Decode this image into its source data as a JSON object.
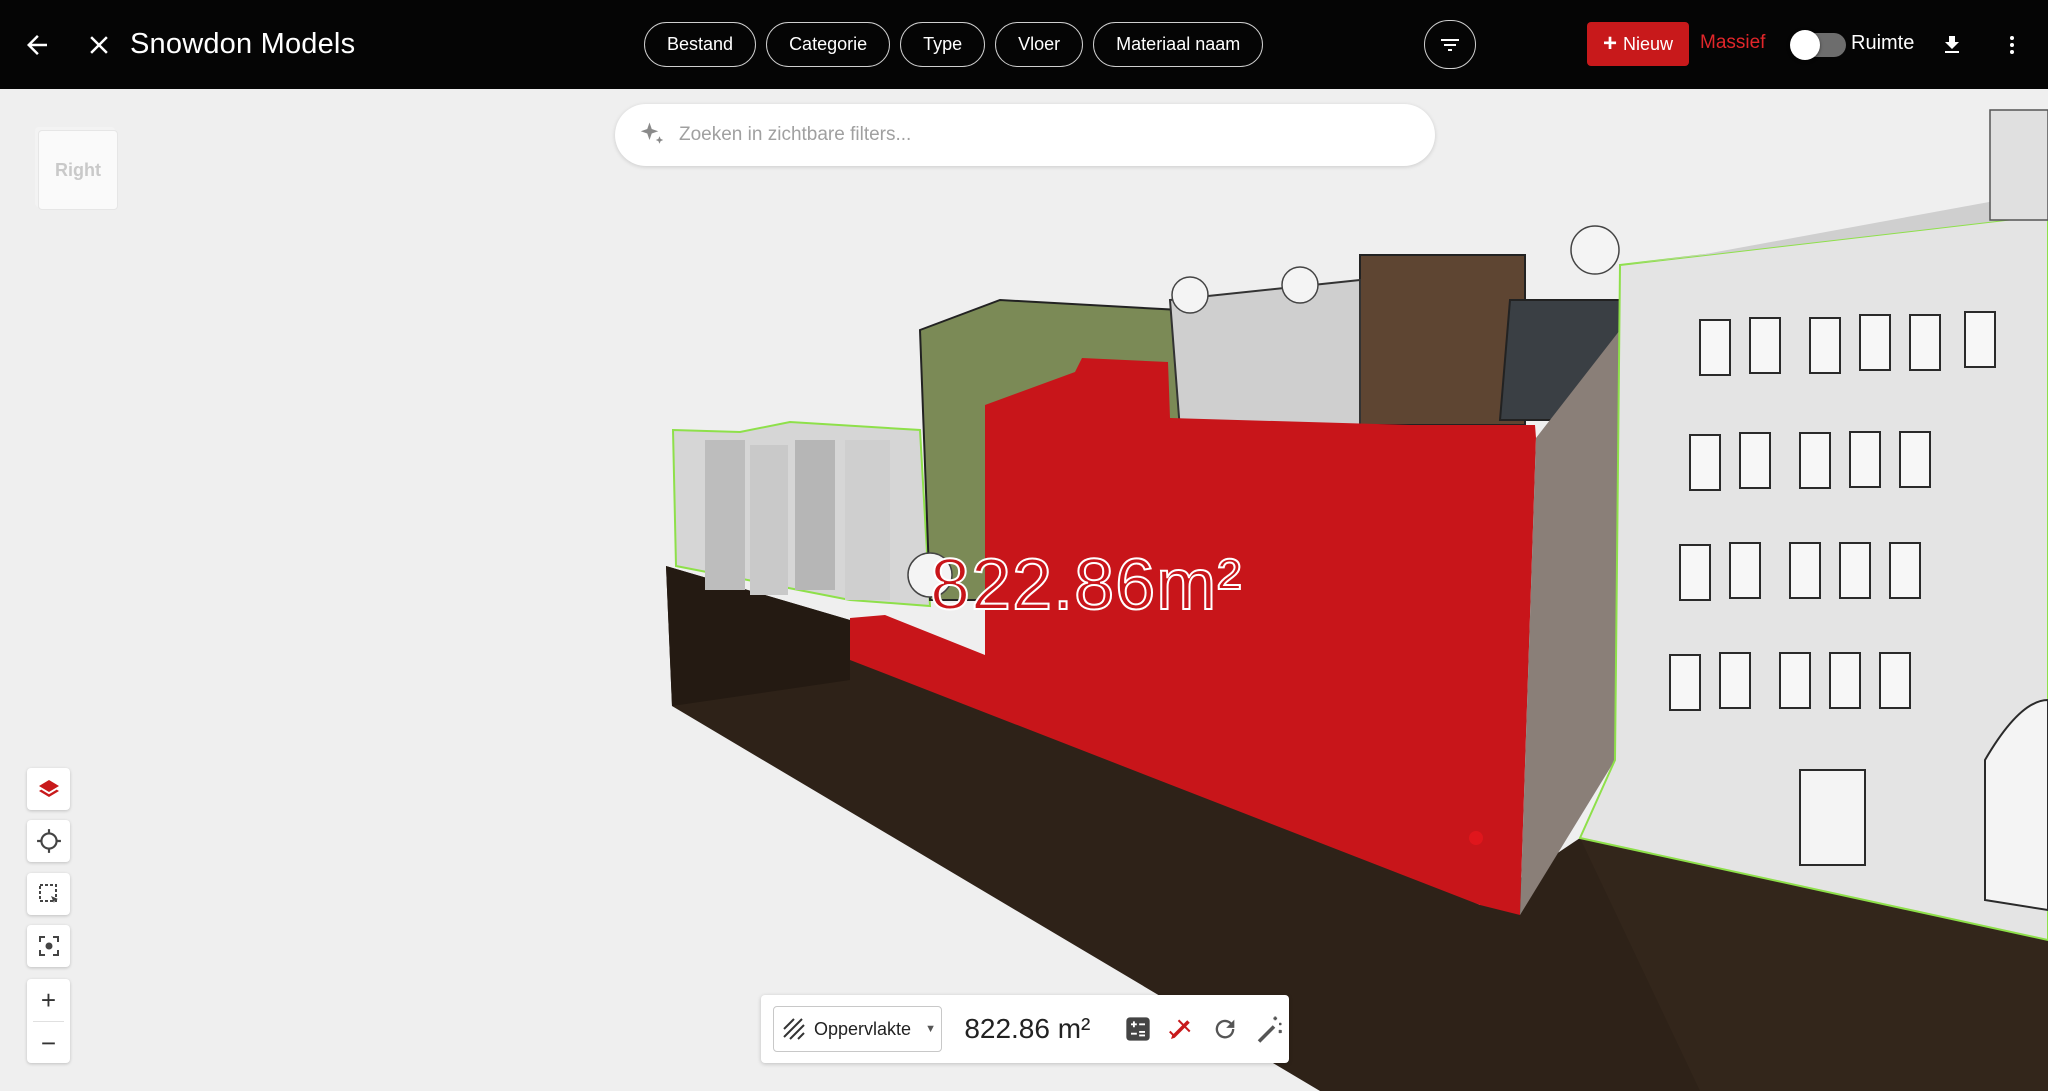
{
  "app": {
    "title": "Snowdon Models"
  },
  "filters": {
    "chips": [
      {
        "label": "Bestand"
      },
      {
        "label": "Categorie"
      },
      {
        "label": "Type"
      },
      {
        "label": "Vloer"
      },
      {
        "label": "Materiaal naam"
      }
    ]
  },
  "toolbar": {
    "new_label": "Nieuw",
    "massief_label": "Massief",
    "ruimte_label": "Ruimte",
    "toggle_on": false
  },
  "search": {
    "placeholder": "Zoeken in zichtbare filters...",
    "value": ""
  },
  "navcube": {
    "face_label": "Right"
  },
  "viewer": {
    "area_label": "822.86m²"
  },
  "measure": {
    "mode": "Oppervlakte",
    "value": "822.86 m²"
  },
  "colors": {
    "accent": "#c8191b",
    "massief": "#e1262a",
    "highlight": "#c8151a",
    "edge": "#8ee04a"
  },
  "icons": {
    "back": "arrow-left-icon",
    "close": "close-icon",
    "filter": "filter-icon",
    "download": "download-icon",
    "more": "more-vertical-icon",
    "search": "sparkle-icon"
  }
}
